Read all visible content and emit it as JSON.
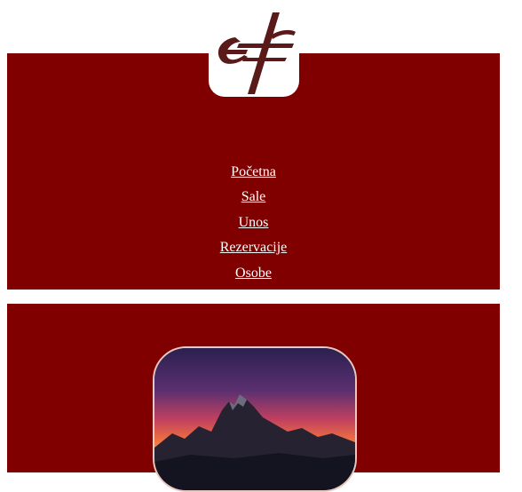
{
  "logo": {
    "name": "logo-icon",
    "monogram": "ef"
  },
  "nav": {
    "items": [
      {
        "label": "Početna"
      },
      {
        "label": "Sale"
      },
      {
        "label": "Unos"
      },
      {
        "label": "Rezervacije"
      },
      {
        "label": "Osobe"
      }
    ]
  },
  "hero": {
    "name": "mountain-sunset-image"
  },
  "colors": {
    "brand": "#800000",
    "background": "#ffffff",
    "logo": "#5a1a1a"
  }
}
